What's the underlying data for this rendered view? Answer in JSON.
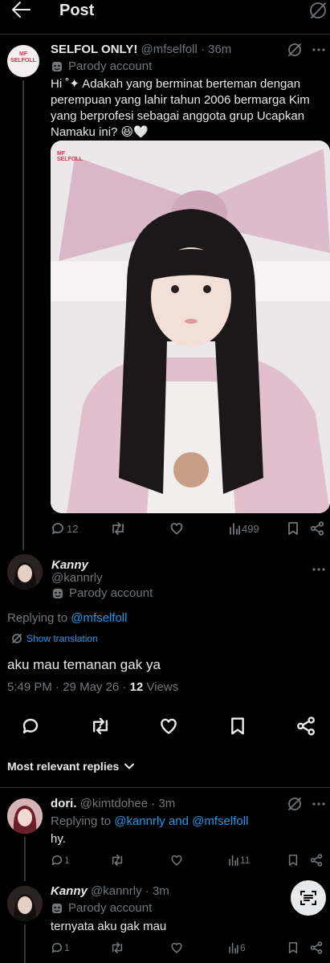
{
  "header": {
    "title": "Post"
  },
  "quoted": {
    "avatar_text_top": "MF",
    "avatar_text": "SELFOLL",
    "name": "SELFOL ONLY!",
    "handle": "@mfselfoll",
    "time": "36m",
    "parody": "Parody account",
    "text": "Hi ˚✦ Adakah yang berminat berteman dengan perempuan yang lahir tahun 2006 bermarga Kim yang berprofesi sebagai anggota grup Ucapkan Namaku ini? 😆🤍",
    "image_watermark_top": "MF",
    "image_watermark": "SELFOLL",
    "actions": {
      "replies": "12",
      "views": "499"
    }
  },
  "main": {
    "name": "Kanny",
    "handle": "@kannrly",
    "parody": "Parody account",
    "replying_prefix": "Replying to",
    "replying_to": "@mfselfoll",
    "show_translation": "Show translation",
    "text": "aku mau temanan gak ya",
    "time": "5:49 PM",
    "date": "29 May 26",
    "views_count": "12",
    "views_label": "Views"
  },
  "replies_section": {
    "label": "Most relevant replies"
  },
  "replies": [
    {
      "name": "dori.",
      "handle": "@kimtdohee",
      "time": "3m",
      "replying_prefix": "Replying to",
      "replying_to": "@kannrly and @mfselfoll",
      "text": "hy.",
      "replies": "1",
      "views": "11"
    },
    {
      "name": "Kanny",
      "handle": "@kannrly",
      "time": "3m",
      "parody": "Parody account",
      "text": "ternyata aku gak mau",
      "replies": "1",
      "views": "6"
    }
  ],
  "colors": {
    "accent": "#1d9bf0",
    "muted": "#71767b",
    "background": "#000000"
  }
}
